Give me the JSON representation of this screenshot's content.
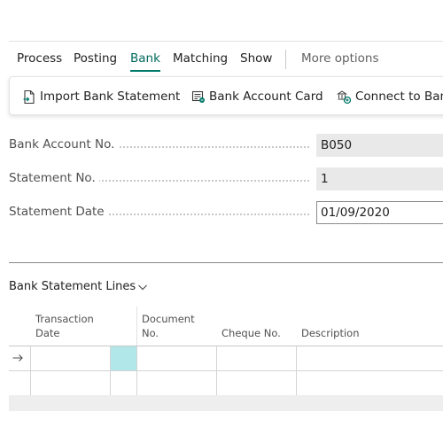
{
  "menu": {
    "items": [
      "Process",
      "Posting",
      "Bank",
      "Matching",
      "Show"
    ],
    "active": "Bank",
    "more_options": "More options"
  },
  "actions": {
    "import_bank_statement": "Import Bank Statement",
    "bank_account_card": "Bank Account Card",
    "connect_to_bank": "Connect to Bank"
  },
  "fields": {
    "bank_account_no": {
      "label": "Bank Account No.",
      "value": "B050"
    },
    "statement_no": {
      "label": "Statement No.",
      "value": "1"
    },
    "statement_date": {
      "label": "Statement Date",
      "value": "01/09/2020"
    }
  },
  "lines": {
    "title": "Bank Statement Lines",
    "columns": {
      "transaction_date": [
        "Transaction",
        "Date"
      ],
      "document_no": [
        "Document",
        "No."
      ],
      "cheque_no": "Cheque No.",
      "description": "Description"
    }
  },
  "colors": {
    "accent": "#00796b",
    "highlight_cell": "#b2e7ea"
  },
  "icons": {
    "import": "document-import-icon",
    "card": "bank-card-icon",
    "connect": "bank-connect-icon",
    "chevron": "chevron-down-icon",
    "row_arrow": "arrow-right-icon"
  }
}
